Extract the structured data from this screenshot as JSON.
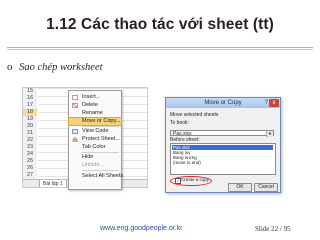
{
  "slide": {
    "title": "1.12 Các thao tác với sheet (tt)",
    "bullet_mark": "o",
    "bullet_text": "Sao chép worksheet"
  },
  "excel": {
    "row_numbers": [
      "15",
      "16",
      "17",
      "18",
      "19",
      "20",
      "21",
      "22",
      "23",
      "24",
      "25",
      "26",
      "27"
    ],
    "sheet_tab": "Bài tập 1"
  },
  "context_menu": {
    "items": [
      "Insert...",
      "Delete",
      "Rename",
      "Move or Copy...",
      "View Code",
      "Protect Sheet...",
      "Tab Color",
      "Hide",
      "Unhide...",
      "Select All Sheets"
    ],
    "highlighted": "Move or Copy..."
  },
  "dialog": {
    "title": "Move or Copy",
    "help": "?",
    "close": "x",
    "move_label": "Move selected sheets",
    "to_book_label": "To book:",
    "to_book_value": "Pas.xlsx",
    "before_label": "Before sheet:",
    "sheets": [
      "Pas sklz",
      "Bang luy",
      "Bang lương",
      "(move to end)"
    ],
    "copy_label": "Create a copy",
    "ok": "OK",
    "cancel": "Cancel"
  },
  "footer": {
    "url": "www.eng.goodpeople.or.kr",
    "slide_number": "Slide 22  / 95"
  },
  "colors": {
    "highlight": "#f5d27a",
    "selection": "#3a6fd0",
    "circle": "#e02020",
    "url": "#2e4da0"
  }
}
